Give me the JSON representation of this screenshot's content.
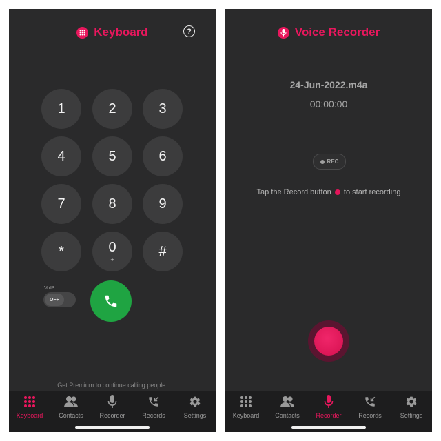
{
  "colors": {
    "accent": "#e8175d",
    "call_green": "#1fa442",
    "tab_inactive": "#9a9a9a"
  },
  "left": {
    "title": "Keyboard",
    "title_icon": "keypad-grid-icon",
    "help_label": "?",
    "keys": [
      {
        "main": "1",
        "sub": ""
      },
      {
        "main": "2",
        "sub": ""
      },
      {
        "main": "3",
        "sub": ""
      },
      {
        "main": "4",
        "sub": ""
      },
      {
        "main": "5",
        "sub": ""
      },
      {
        "main": "6",
        "sub": ""
      },
      {
        "main": "7",
        "sub": ""
      },
      {
        "main": "8",
        "sub": ""
      },
      {
        "main": "9",
        "sub": ""
      },
      {
        "main": "*",
        "sub": ""
      },
      {
        "main": "0",
        "sub": "+"
      },
      {
        "main": "#",
        "sub": ""
      }
    ],
    "voip_label": "VoIP",
    "voip_state": "OFF",
    "call_icon": "phone-icon",
    "premium_text": "Get Premium to continue calling people.",
    "active_tab": 0
  },
  "right": {
    "title": "Voice Recorder",
    "title_icon": "microphone-icon",
    "filename": "24-Jun-2022.m4a",
    "timer": "00:00:00",
    "rec_label": "REC",
    "hint_before": "Tap the Record button",
    "hint_after": "to start recording",
    "active_tab": 2
  },
  "tabs": [
    {
      "label": "Keyboard",
      "icon": "keypad-icon"
    },
    {
      "label": "Contacts",
      "icon": "contacts-icon"
    },
    {
      "label": "Recorder",
      "icon": "microphone-icon"
    },
    {
      "label": "Records",
      "icon": "incoming-call-icon"
    },
    {
      "label": "Settings",
      "icon": "gear-icon"
    }
  ]
}
